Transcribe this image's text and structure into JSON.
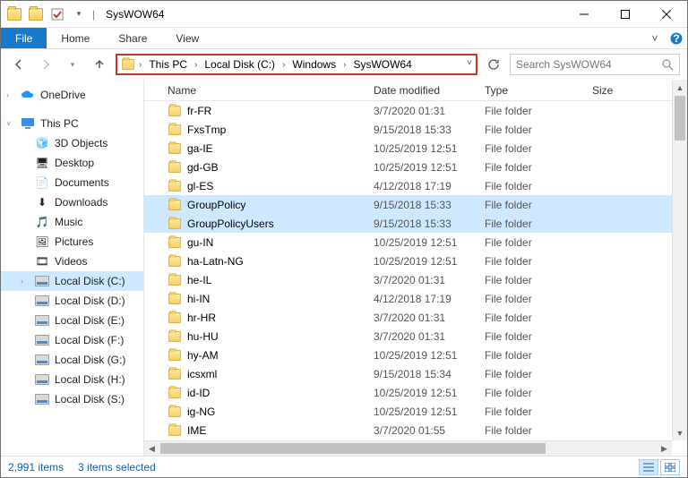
{
  "window": {
    "title": "SysWOW64"
  },
  "ribbon": {
    "file": "File",
    "tabs": [
      "Home",
      "Share",
      "View"
    ]
  },
  "breadcrumb": [
    "This PC",
    "Local Disk (C:)",
    "Windows",
    "SysWOW64"
  ],
  "search": {
    "placeholder": "Search SysWOW64"
  },
  "navpane": {
    "onedrive": "OneDrive",
    "thispc": "This PC",
    "libs": [
      "3D Objects",
      "Desktop",
      "Documents",
      "Downloads",
      "Music",
      "Pictures",
      "Videos"
    ],
    "drives": [
      "Local Disk (C:)",
      "Local Disk (D:)",
      "Local Disk (E:)",
      "Local Disk (F:)",
      "Local Disk (G:)",
      "Local Disk (H:)",
      "Local Disk (S:)"
    ]
  },
  "columns": {
    "name": "Name",
    "date": "Date modified",
    "type": "Type",
    "size": "Size"
  },
  "rows": [
    {
      "name": "fr-FR",
      "date": "3/7/2020 01:31",
      "type": "File folder",
      "sel": false
    },
    {
      "name": "FxsTmp",
      "date": "9/15/2018 15:33",
      "type": "File folder",
      "sel": false
    },
    {
      "name": "ga-IE",
      "date": "10/25/2019 12:51",
      "type": "File folder",
      "sel": false
    },
    {
      "name": "gd-GB",
      "date": "10/25/2019 12:51",
      "type": "File folder",
      "sel": false
    },
    {
      "name": "gl-ES",
      "date": "4/12/2018 17:19",
      "type": "File folder",
      "sel": false
    },
    {
      "name": "GroupPolicy",
      "date": "9/15/2018 15:33",
      "type": "File folder",
      "sel": true
    },
    {
      "name": "GroupPolicyUsers",
      "date": "9/15/2018 15:33",
      "type": "File folder",
      "sel": true
    },
    {
      "name": "gu-IN",
      "date": "10/25/2019 12:51",
      "type": "File folder",
      "sel": false
    },
    {
      "name": "ha-Latn-NG",
      "date": "10/25/2019 12:51",
      "type": "File folder",
      "sel": false
    },
    {
      "name": "he-IL",
      "date": "3/7/2020 01:31",
      "type": "File folder",
      "sel": false
    },
    {
      "name": "hi-IN",
      "date": "4/12/2018 17:19",
      "type": "File folder",
      "sel": false
    },
    {
      "name": "hr-HR",
      "date": "3/7/2020 01:31",
      "type": "File folder",
      "sel": false
    },
    {
      "name": "hu-HU",
      "date": "3/7/2020 01:31",
      "type": "File folder",
      "sel": false
    },
    {
      "name": "hy-AM",
      "date": "10/25/2019 12:51",
      "type": "File folder",
      "sel": false
    },
    {
      "name": "icsxml",
      "date": "9/15/2018 15:34",
      "type": "File folder",
      "sel": false
    },
    {
      "name": "id-ID",
      "date": "10/25/2019 12:51",
      "type": "File folder",
      "sel": false
    },
    {
      "name": "ig-NG",
      "date": "10/25/2019 12:51",
      "type": "File folder",
      "sel": false
    },
    {
      "name": "IME",
      "date": "3/7/2020 01:55",
      "type": "File folder",
      "sel": false
    }
  ],
  "status": {
    "count": "2,991 items",
    "selection": "3 items selected"
  }
}
